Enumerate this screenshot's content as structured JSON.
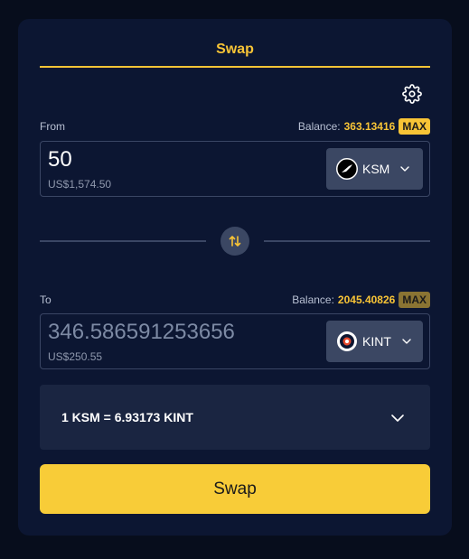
{
  "tabs": [
    {
      "label": "Swap",
      "active": true
    }
  ],
  "colors": {
    "accent": "#f8c436",
    "card_bg": "#0c1632",
    "page_bg": "#070d1c",
    "button_bg": "#3b4763"
  },
  "from": {
    "label": "From",
    "balance_label": "Balance:",
    "balance_value": "363.13416",
    "max_label": "MAX",
    "amount": "50",
    "usd_value": "US$1,574.50",
    "token": {
      "symbol": "KSM",
      "icon": "ksm-token-icon"
    }
  },
  "to": {
    "label": "To",
    "balance_label": "Balance:",
    "balance_value": "2045.40826",
    "max_label": "MAX",
    "amount": "346.586591253656",
    "usd_value": "US$250.55",
    "token": {
      "symbol": "KINT",
      "icon": "kint-token-icon"
    }
  },
  "rate": {
    "text": "1 KSM = 6.93173 KINT"
  },
  "swap_button": {
    "label": "Swap"
  },
  "icons": {
    "settings": "gear-icon",
    "switch": "swap-arrows-icon",
    "dropdown": "chevron-down-icon"
  }
}
